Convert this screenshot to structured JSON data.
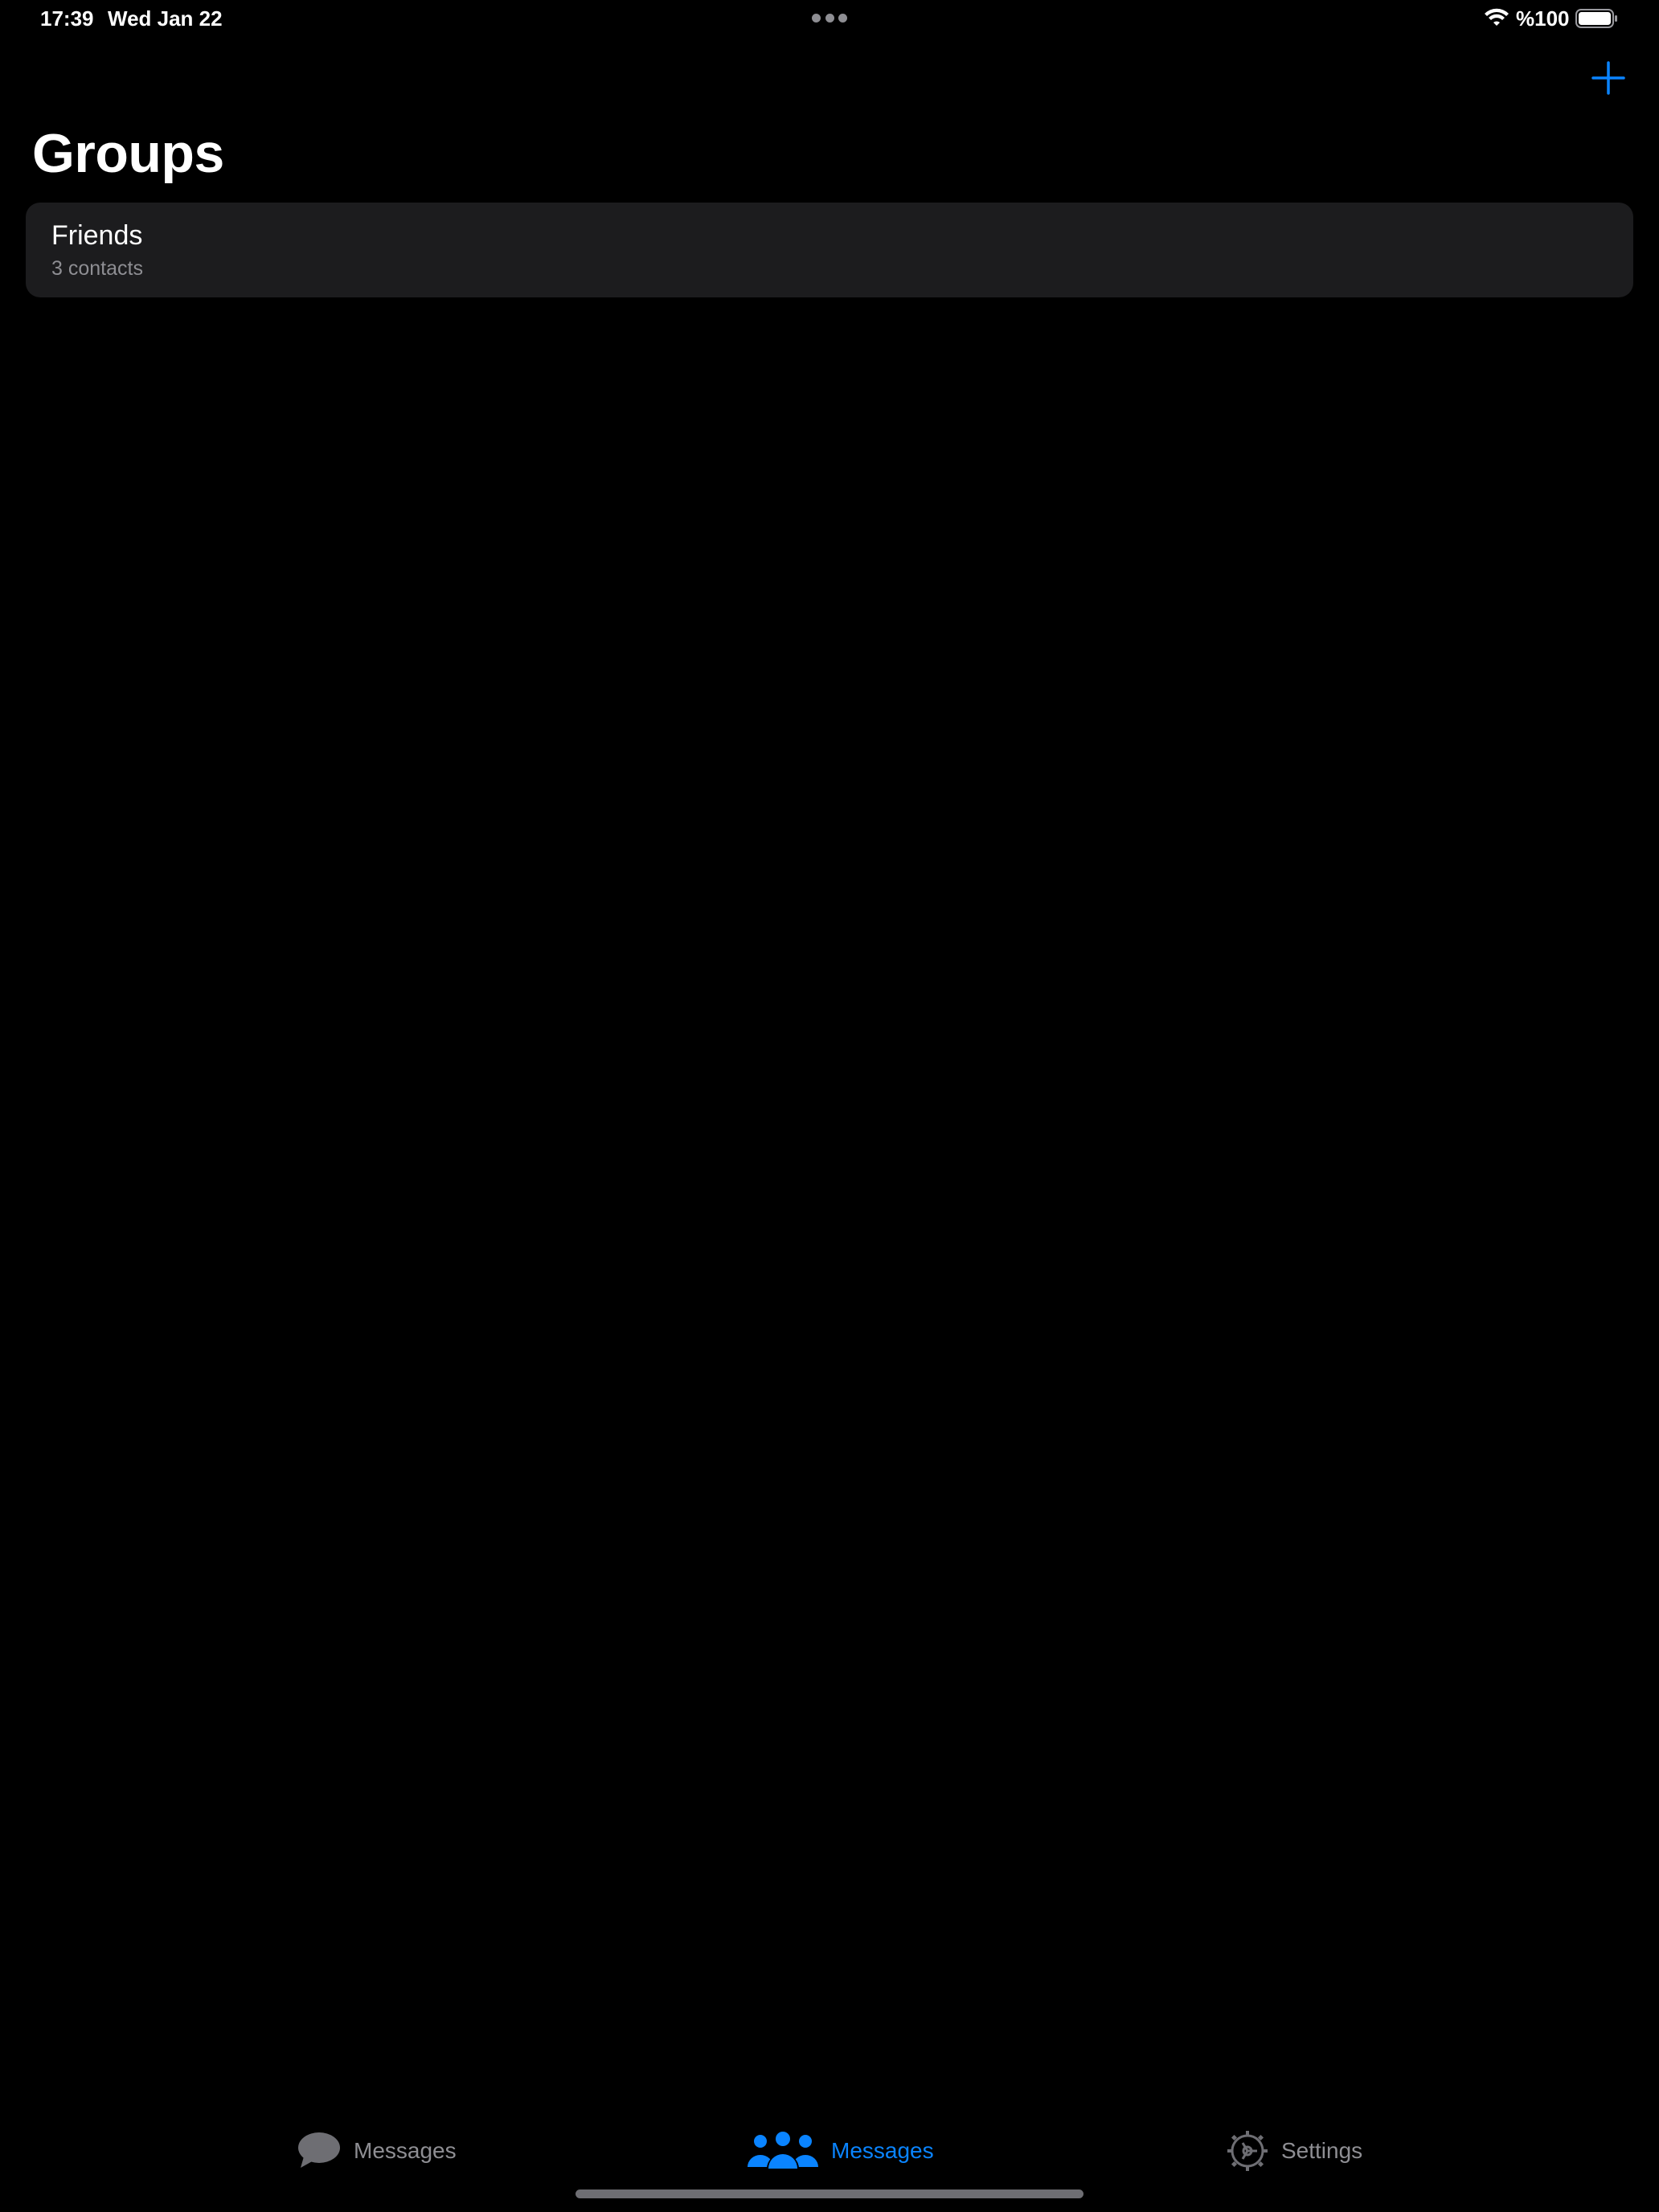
{
  "status_bar": {
    "time": "17:39",
    "date": "Wed Jan 22",
    "battery_percent": "%100",
    "wifi_icon": "wifi-icon",
    "battery_icon": "battery-full-icon"
  },
  "nav": {
    "add_icon": "plus-icon",
    "title": "Groups"
  },
  "groups": [
    {
      "name": "Friends",
      "subtitle": "3 contacts"
    }
  ],
  "tab_bar": {
    "items": [
      {
        "label": "Messages",
        "icon": "chat-bubble-icon",
        "active": false
      },
      {
        "label": "Messages",
        "icon": "people-icon",
        "active": true
      },
      {
        "label": "Settings",
        "icon": "gear-icon",
        "active": false
      }
    ]
  },
  "colors": {
    "background": "#000000",
    "card": "#1c1c1e",
    "accent": "#0a84ff",
    "secondary_text": "#8e8e93"
  }
}
